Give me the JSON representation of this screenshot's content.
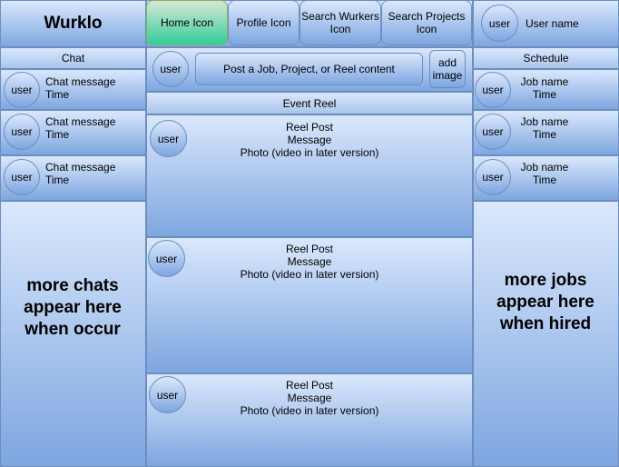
{
  "app": {
    "title": "Wurklo"
  },
  "nav": {
    "tabs": [
      {
        "label": "Home Icon",
        "active": true
      },
      {
        "label": "Profile Icon",
        "active": false
      },
      {
        "label": "Search Wurkers Icon",
        "active": false
      },
      {
        "label": "Search Projects Icon",
        "active": false
      }
    ]
  },
  "user_header": {
    "avatar": "user",
    "name": "User name"
  },
  "chat": {
    "header": "Chat",
    "items": [
      {
        "avatar": "user",
        "message": "Chat message",
        "time": "Time"
      },
      {
        "avatar": "user",
        "message": "Chat message",
        "time": "Time"
      },
      {
        "avatar": "user",
        "message": "Chat message",
        "time": "Time"
      }
    ],
    "more_text": "more chats appear here when occur"
  },
  "post": {
    "avatar": "user",
    "prompt": "Post a Job, Project, or Reel content",
    "add_image": "add image"
  },
  "reel": {
    "header": "Event Reel",
    "posts": [
      {
        "avatar": "user",
        "title": "Reel Post",
        "message": "Message",
        "photo": "Photo (video in later version)"
      },
      {
        "avatar": "user",
        "title": "Reel Post",
        "message": "Message",
        "photo": "Photo (video in later version)"
      },
      {
        "avatar": "user",
        "title": "Reel Post",
        "message": "Message",
        "photo": "Photo (video in later version)"
      }
    ]
  },
  "schedule": {
    "header": "Schedule",
    "items": [
      {
        "avatar": "user",
        "job": "Job name",
        "time": "Time"
      },
      {
        "avatar": "user",
        "job": "Job name",
        "time": "Time"
      },
      {
        "avatar": "user",
        "job": "Job name",
        "time": "Time"
      }
    ],
    "more_text": "more jobs appear here when hired"
  },
  "colors": {
    "panel_top": "#dae8fc",
    "panel_bottom": "#7ea6e0",
    "border": "#6c8ebf",
    "active_top": "#d5e8d4",
    "active_bottom": "#33cc99"
  }
}
